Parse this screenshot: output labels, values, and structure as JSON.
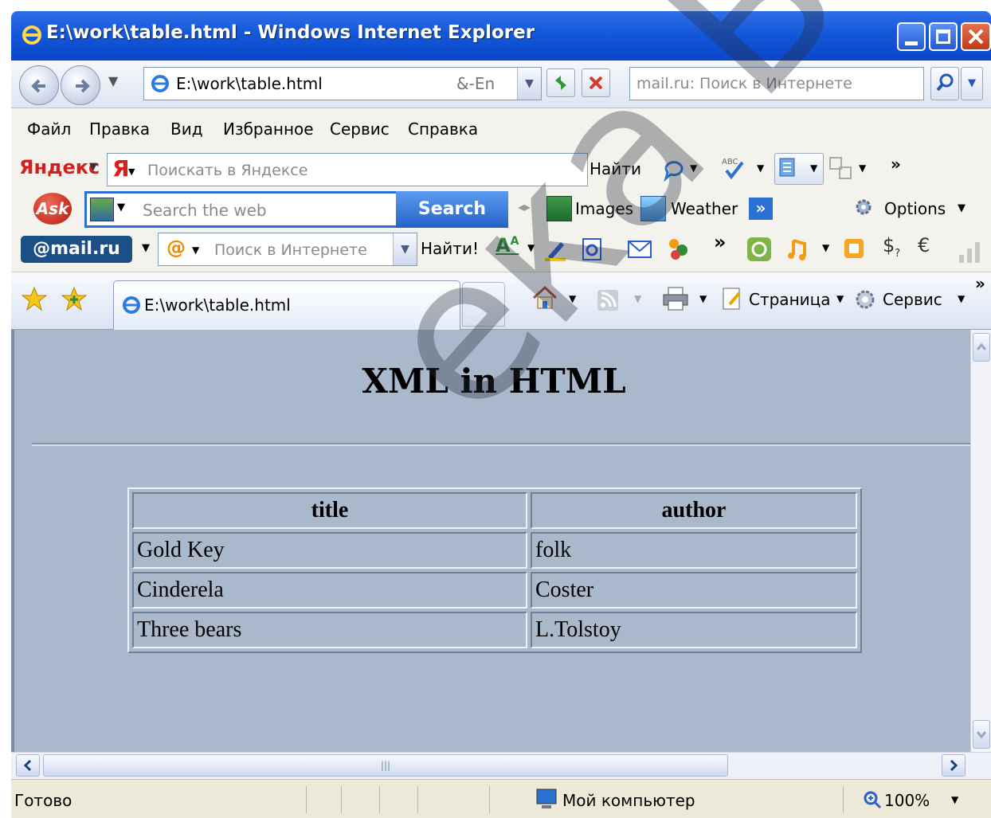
{
  "window": {
    "title": "E:\\work\\table.html - Windows Internet Explorer"
  },
  "nav": {
    "address": "E:\\work\\table.html",
    "search_placeholder": "mail.ru: Поиск в Интернете",
    "lang_badge": "&-En"
  },
  "menu": [
    "Файл",
    "Правка",
    "Вид",
    "Избранное",
    "Сервис",
    "Справка"
  ],
  "yandex": {
    "brand": "Яндекс",
    "placeholder": "Поискать в Яндексе",
    "find": "Найти"
  },
  "ask": {
    "brand": "Ask",
    "placeholder": "Search the web",
    "search": "Search",
    "images": "Images",
    "weather": "Weather",
    "options": "Options"
  },
  "mailru": {
    "brand": "@mail.ru",
    "placeholder": "Поиск в Интернете",
    "find": "Найти!"
  },
  "tabs": {
    "active_tab": "E:\\work\\table.html",
    "page_menu": "Страница",
    "tools_menu": "Сервис"
  },
  "content": {
    "heading": "XML in HTML",
    "table": {
      "headers": [
        "title",
        "author"
      ],
      "rows": [
        [
          "Gold Key",
          "folk"
        ],
        [
          "Cinderela",
          "Coster"
        ],
        [
          "Three bears",
          "L.Tolstoy"
        ]
      ]
    }
  },
  "status": {
    "text": "Готово",
    "zone": "Мой компьютер",
    "zoom": "100%"
  },
  "watermark": "ека БГУИР",
  "colors": {
    "title_bar": "#1458db",
    "content_bg": "#aab8cc",
    "ask_search_button": "#2a6fd1"
  }
}
